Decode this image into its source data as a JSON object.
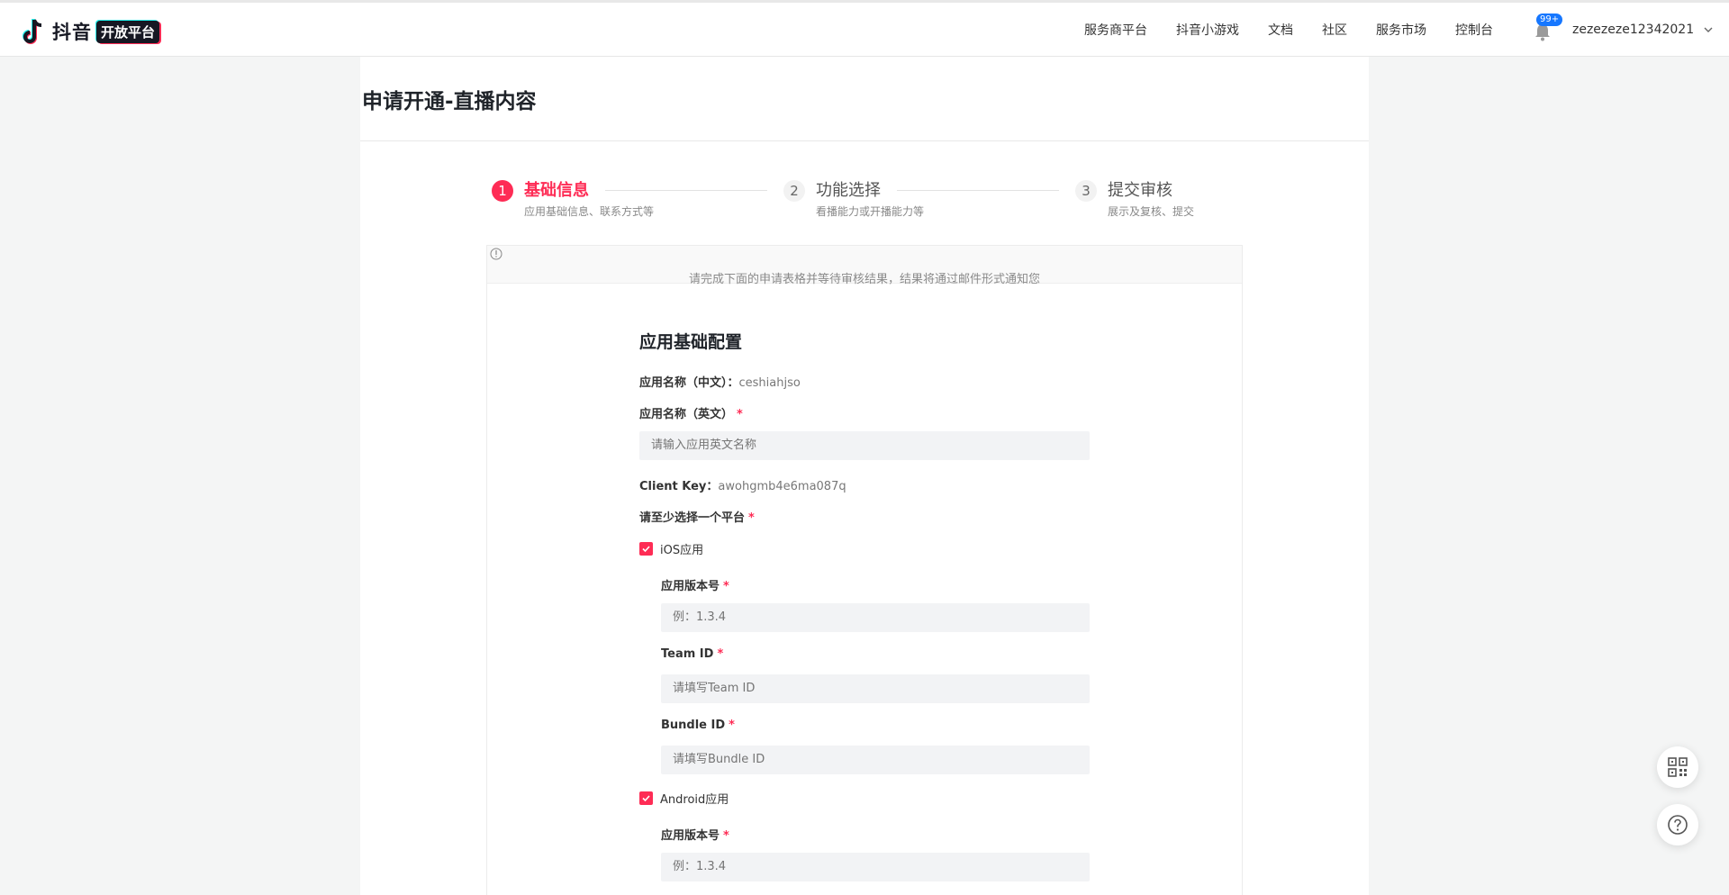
{
  "brand": {
    "name": "抖音",
    "badge": "开放平台"
  },
  "nav": {
    "items": [
      "服务商平台",
      "抖音小游戏",
      "文档",
      "社区",
      "服务市场",
      "控制台"
    ]
  },
  "notifications": {
    "count": "99+"
  },
  "user": {
    "name": "zezezeze12342021"
  },
  "page": {
    "title": "申请开通-直播内容"
  },
  "steps": [
    {
      "num": "1",
      "label": "基础信息",
      "sub": "应用基础信息、联系方式等"
    },
    {
      "num": "2",
      "label": "功能选择",
      "sub": "看播能力或开播能力等"
    },
    {
      "num": "3",
      "label": "提交审核",
      "sub": "展示及复核、提交"
    }
  ],
  "notice": {
    "text": "请完成下面的申请表格并等待审核结果，结果将通过邮件形式通知您"
  },
  "form": {
    "section_title": "应用基础配置",
    "name_cn_label": "应用名称（中文）：",
    "name_cn_value": "ceshiahjso",
    "name_en_label": "应用名称（英文）",
    "name_en_placeholder": "请输入应用英文名称",
    "client_key_label": "Client Key：",
    "client_key_value": "awohgmb4e6ma087q",
    "platform_label": "请至少选择一个平台",
    "required_mark": "*",
    "ios": {
      "label": "iOS应用",
      "version_label": "应用版本号",
      "version_placeholder": "例：1.3.4",
      "team_label": "Team ID",
      "team_placeholder": "请填写Team ID",
      "bundle_label": "Bundle ID",
      "bundle_placeholder": "请填写Bundle ID"
    },
    "android": {
      "label": "Android应用",
      "version_label": "应用版本号",
      "version_placeholder": "例：1.3.4"
    }
  },
  "colors": {
    "accent": "#fe2c55",
    "badge_blue": "#1677ff"
  }
}
